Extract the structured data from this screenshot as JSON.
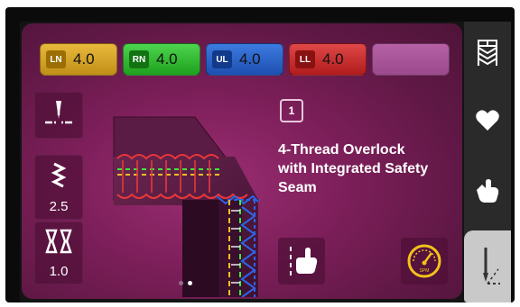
{
  "thread_tensions": [
    {
      "code": "LN",
      "value": "4.0"
    },
    {
      "code": "RN",
      "value": "4.0"
    },
    {
      "code": "UL",
      "value": "4.0"
    },
    {
      "code": "LL",
      "value": "4.0"
    }
  ],
  "stitch_length": {
    "value": "2.5",
    "icon": "stitch-length-icon"
  },
  "differential_feed": {
    "value": "1.0",
    "icon": "differential-feed-icon"
  },
  "stitch": {
    "number": "1",
    "name": "4-Thread Overlock\nwith Integrated Safety\nSeam"
  },
  "right_tabs": [
    {
      "icon": "stitch-menu-icon"
    },
    {
      "icon": "heart-icon"
    },
    {
      "icon": "hand-icon"
    },
    {
      "icon": "sewing-mode-icon"
    }
  ],
  "colors": {
    "ln": "#d9a62a",
    "rn": "#2fbf2f",
    "ul": "#2d64c8",
    "ll": "#c92f2f",
    "background": "#7d1f5a",
    "accent_yellow": "#f2c21b"
  }
}
